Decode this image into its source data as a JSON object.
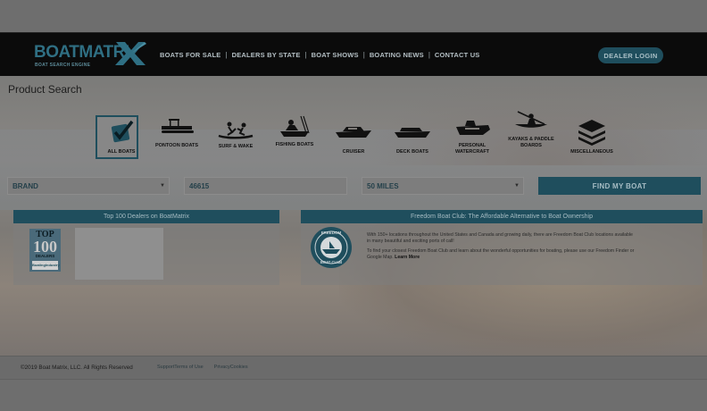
{
  "header": {
    "logo_text": "BOATMATRI",
    "logo_tagline": "BOAT SEARCH ENGINE",
    "nav": [
      "BOATS FOR SALE",
      "DEALERS BY STATE",
      "BOAT SHOWS",
      "BOATING NEWS",
      "CONTACT US"
    ],
    "separator": "|",
    "dealer_login": "DEALER LOGIN"
  },
  "page_title": "Product Search",
  "categories": [
    {
      "label": "ALL BOATS",
      "icon": "all-boats-check-icon",
      "active": true
    },
    {
      "label": "PONTOON BOATS",
      "icon": "pontoon-boat-icon"
    },
    {
      "label": "SURF & WAKE",
      "icon": "surf-wake-icon"
    },
    {
      "label": "FISHING BOATS",
      "icon": "fishing-boat-icon"
    },
    {
      "label": "CRUISER",
      "icon": "cruiser-icon"
    },
    {
      "label": "DECK BOATS",
      "icon": "deck-boat-icon"
    },
    {
      "label": "PERSONAL WATERCRAFT",
      "icon": "personal-watercraft-icon"
    },
    {
      "label": "KAYAKS & PADDLE BOARDS",
      "icon": "kayak-icon"
    },
    {
      "label": "MISCELLANEOUS",
      "icon": "layers-icon"
    }
  ],
  "search": {
    "brand": "BRAND",
    "zip": "46615",
    "radius": "50 MILES",
    "button": "FIND MY BOAT"
  },
  "top100": {
    "title": "Top 100 Dealers on BoatMatrix",
    "badge_top": "TOP",
    "badge_num": "100",
    "badge_sub": "DEALERS",
    "badge_brand": "BoatingIndustry"
  },
  "fbc": {
    "title": "Freedom Boat Club: The Affordable Alternative to Boat Ownership",
    "seal_top": "FREEDOM",
    "seal_bottom": "BOAT CLUB",
    "p1": "With 150+ locations throughout the United States and Canada and growing daily, there are Freedom Boat Club locations available in many beautiful and exciting ports of call!",
    "p2": "To find your closest Freedom Boat Club and learn about the wonderful opportunities for boating, please use our Freedom Finder or Google Map.",
    "learn_more": "Learn More"
  },
  "footer": {
    "copyright": "©2019 Boat Matrix, LLC. All Rights Reserved",
    "support": "Support",
    "terms": "Terms of Use",
    "privacy": "Privacy",
    "cookies": "Cookies"
  },
  "colors": {
    "accent": "#1f4e5d",
    "overlay": "#6b6b6b",
    "navbar": "#0b0b0b"
  }
}
